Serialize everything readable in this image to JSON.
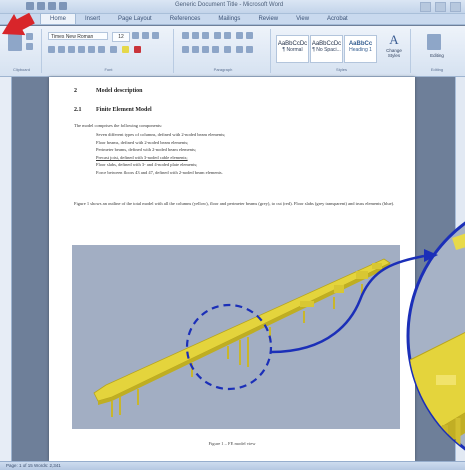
{
  "window": {
    "title": "Generic Document Title - Microsoft Word"
  },
  "ribbon": {
    "tabs": [
      "Home",
      "Insert",
      "Page Layout",
      "References",
      "Mailings",
      "Review",
      "View",
      "Acrobat"
    ],
    "font_name": "Times New Roman",
    "font_size": "12",
    "styles": [
      {
        "sample": "AaBbCcDc",
        "label": "¶ Normal"
      },
      {
        "sample": "AaBbCcDc",
        "label": "¶ No Spaci..."
      },
      {
        "sample": "AaBbCc",
        "label": "Heading 1"
      }
    ],
    "groups": [
      "Clipboard",
      "Font",
      "Paragraph",
      "Styles",
      "Editing"
    ],
    "change_styles_label": "Change Styles",
    "editing_label": "Editing"
  },
  "document": {
    "heading1_num": "2",
    "heading1": "Model description",
    "heading2_num": "2.1",
    "heading2": "Finite Element Model",
    "intro": "The model comprises the following components:",
    "bullets": [
      "Seven different types of columns, defined with 2-noded beam elements;",
      "Floor beams, defined with 2-noded beam elements;",
      "Perimeter beams, defined with 2-noded beam elements;",
      "Precast joist, defined with 3-noded cable elements;",
      "Floor slabs, defined with 3- and 4-noded plate elements;",
      "Force between floors 43 and 47, defined with 2-noded beam elements."
    ],
    "figure_intro": "Figure 1 shows an outline of the total model with all the columns (yellow), floor and perimeter beams (grey), to cut (red). Floor slabs (grey transparent) and truss elements (blue).",
    "figure_caption": "Figure 1 – FE model view"
  },
  "status": {
    "text": "Page: 1 of 15   Words: 2,341"
  },
  "colors": {
    "annotation_blue": "#1b2fb8",
    "model_yellow": "#e2d23a",
    "pointer_red": "#d8252a",
    "figure_bg": "#a2aec3"
  }
}
